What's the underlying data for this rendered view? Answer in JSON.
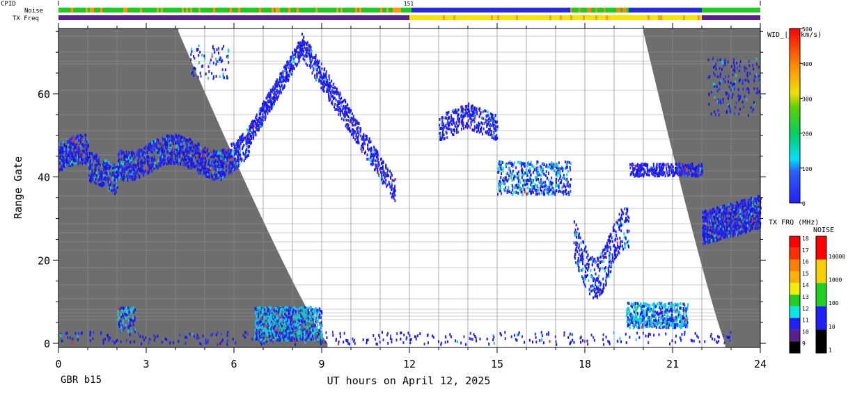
{
  "header": {
    "cpid_label": "CPID",
    "cpid_value": "151",
    "noise_label": "Noise",
    "txfreq_label": "TX Freq"
  },
  "chart_data": {
    "type": "heatmap",
    "title": "",
    "xlabel": "UT hours on April 12, 2025",
    "ylabel": "Range Gate",
    "station": "GBR b15",
    "xlim": [
      0,
      24
    ],
    "ylim": [
      0,
      75
    ],
    "x_ticks": [
      "0",
      "3",
      "6",
      "9",
      "12",
      "15",
      "18",
      "21",
      "24"
    ],
    "y_ticks": [
      "0",
      "20",
      "40",
      "60"
    ],
    "colorbars": [
      {
        "name": "WID_|_ (km/s)",
        "ticks": [
          "500",
          "400",
          "300",
          "200",
          "100",
          "0"
        ]
      },
      {
        "name": "TX FRQ (MHz)",
        "ticks": [
          "18",
          "17",
          "16",
          "15",
          "14",
          "13",
          "12",
          "11",
          "10",
          "9"
        ]
      },
      {
        "name": "NOISE",
        "ticks": [
          "10000",
          "1000",
          "100",
          "10",
          "1"
        ]
      }
    ],
    "ground_scatter_regions": [
      {
        "name": "early",
        "x_end_at_top": 4.1,
        "x_end_at_bottom": 9.2
      },
      {
        "name": "late",
        "x_start_at_top": 20.0,
        "x_start_at_bottom": 22.8
      }
    ],
    "echo_bands": [
      {
        "x": [
          0,
          6.5
        ],
        "gate_center": 45,
        "width": "low"
      },
      {
        "x": [
          6.5,
          8.3
        ],
        "gate_center": "rising 50->72",
        "width": "low"
      },
      {
        "x": [
          8.3,
          11.5
        ],
        "gate_center": "falling 72->35",
        "width": "low"
      },
      {
        "x": [
          13,
          15
        ],
        "gate_center": 52,
        "width": "low"
      },
      {
        "x": [
          15,
          17.5
        ],
        "gate_center": 40,
        "width": "medium"
      },
      {
        "x": [
          19.5,
          22
        ],
        "gate_center": 42,
        "width": "low"
      },
      {
        "x": [
          22,
          24
        ],
        "gate_center": 30,
        "width": "low"
      },
      {
        "x": [
          6.7,
          9
        ],
        "gate_center": 5,
        "width": "medium"
      },
      {
        "x": [
          19.4,
          21.5
        ],
        "gate_center": 7,
        "width": "medium-high"
      }
    ]
  },
  "colors": {
    "ground_scatter": "#6e6e6e",
    "noise_low": "#22c822",
    "noise_high": "#2a2ad8",
    "txfreq_low": "#5a1f8a",
    "txfreq_high": "#f6e400"
  }
}
